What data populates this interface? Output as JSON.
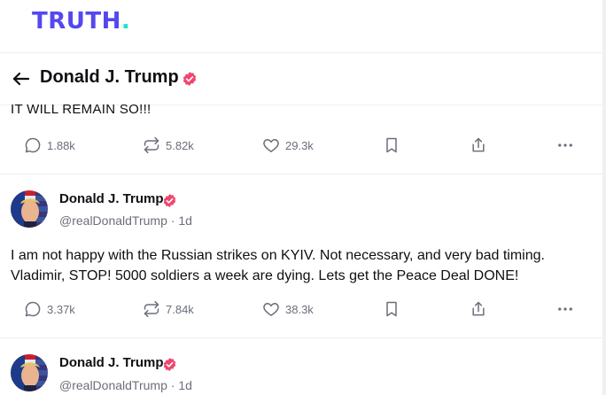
{
  "brand": {
    "logo_text": "TRUTH",
    "logo_dot": ".",
    "primary_color": "#5448ee",
    "dot_color": "#17e6c7"
  },
  "header": {
    "title": "Donald J. Trump",
    "back_icon": "arrow-left-icon",
    "verified_icon": "verified-badge-icon"
  },
  "previous_post": {
    "text_tail": "IT WILL REMAIN SO!!!",
    "actions": {
      "replies": "1.88k",
      "retruths": "5.82k",
      "likes": "29.3k"
    }
  },
  "posts": [
    {
      "author": "Donald J. Trump",
      "handle": "@realDonaldTrump",
      "time": "1d",
      "text": "I am not happy with the Russian strikes on KYIV. Not necessary, and very bad timing. Vladimir, STOP! 5000 soldiers a week are dying. Lets get the Peace Deal DONE!",
      "actions": {
        "replies": "3.37k",
        "retruths": "7.84k",
        "likes": "38.3k"
      }
    },
    {
      "author": "Donald J. Trump",
      "handle": "@realDonaldTrump",
      "time": "1d"
    }
  ],
  "colors": {
    "verified": "#ef476f",
    "muted": "#6b6f7a",
    "divider": "#eceef3"
  },
  "separator": "·"
}
